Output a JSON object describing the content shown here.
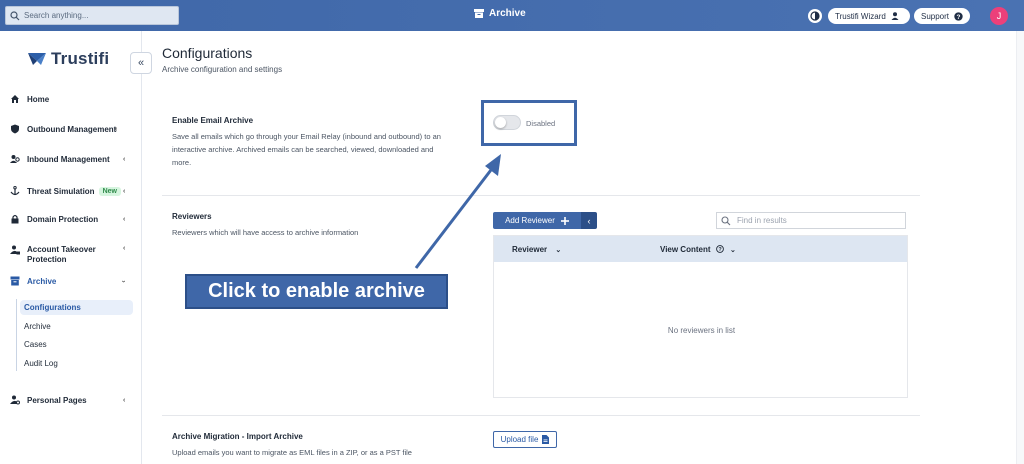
{
  "topbar": {
    "search_placeholder": "Search anything...",
    "title": "Archive",
    "wizard_label": "Trustifi Wizard",
    "support_label": "Support",
    "avatar_initial": "J"
  },
  "sidebar": {
    "logo_text": "Trustifi",
    "items": [
      {
        "label": "Home",
        "icon": "home-icon"
      },
      {
        "label": "Outbound Management",
        "icon": "shield-icon"
      },
      {
        "label": "Inbound Management",
        "icon": "users-icon"
      },
      {
        "label": "Threat Simulation",
        "icon": "anchor-icon",
        "badge": "New"
      },
      {
        "label": "Domain Protection",
        "icon": "lock-icon"
      },
      {
        "label": "Account Takeover Protection",
        "line1": "Account Takeover",
        "line2": "Protection",
        "icon": "user-lock-icon"
      },
      {
        "label": "Archive",
        "icon": "archive-icon"
      },
      {
        "label": "Personal Pages",
        "icon": "user-cog-icon"
      }
    ],
    "archive_sub": [
      "Configurations",
      "Archive",
      "Cases",
      "Audit Log"
    ]
  },
  "main": {
    "title": "Configurations",
    "subtitle": "Archive configuration and settings",
    "archive_section": {
      "title": "Enable Email Archive",
      "description": "Save all emails which go through your Email Relay (inbound and outbound) to an interactive archive. Archived emails can be searched, viewed, downloaded and more.",
      "toggle_state": "Disabled"
    },
    "reviewers_section": {
      "title": "Reviewers",
      "description": "Reviewers which will have access to archive information",
      "add_button": "Add Reviewer",
      "find_placeholder": "Find in results",
      "columns": [
        "Reviewer",
        "View Content"
      ],
      "empty_text": "No reviewers in list"
    },
    "migration_section": {
      "title": "Archive Migration - Import Archive",
      "description": "Upload emails you want to migrate as EML files in a ZIP, or as a PST file",
      "upload_button": "Upload file"
    }
  },
  "callout": {
    "text": "Click to enable archive"
  },
  "colors": {
    "brand_blue": "#3f67a8",
    "active_bg": "#e8effa",
    "badge_green": "#2f8a4a"
  }
}
